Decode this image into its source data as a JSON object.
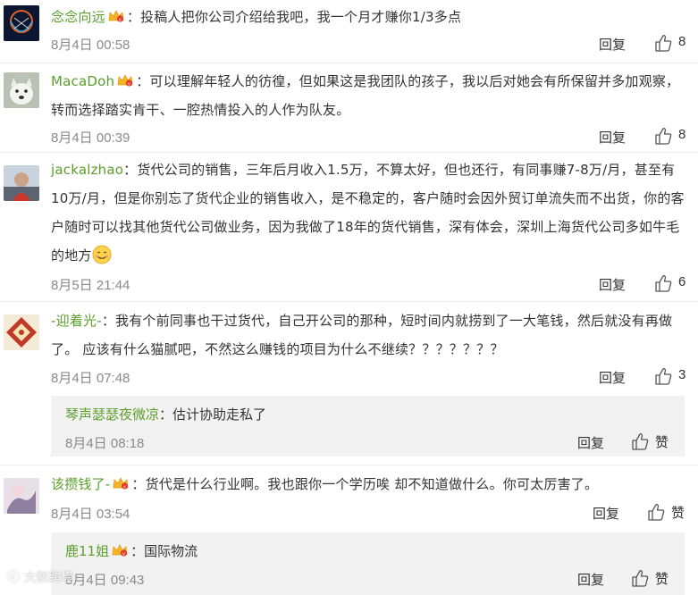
{
  "ui": {
    "reply_label": "回复",
    "like_label": "赞"
  },
  "comments": [
    {
      "user": "念念向远",
      "text": "：投稿人把你公司介绍给我吧，我一个月才赚你1/3多点",
      "time": "8月4日 00:58",
      "likes": "8"
    },
    {
      "user": "MacaDoh",
      "text": "：可以理解年轻人的彷徨，但如果这是我团队的孩子，我以后对她会有所保留并多加观察，转而选择踏实肯干、一腔热情投入的人作为队友。",
      "time": "8月4日 00:39",
      "likes": "8"
    },
    {
      "user": "jackalzhao",
      "text": "：货代公司的销售，三年后月收入1.5万，不算太好，但也还行，有同事赚7-8万/月，甚至有10万/月，但是你别忘了货代企业的销售收入，是不稳定的，客户随时会因外贸订单流失而不出货，你的客户随时可以找其他货代公司做业务，因为我做了18年的货代销售，深有体会，深圳上海货代公司多如牛毛的地方",
      "emoji": "smile-emoji",
      "time": "8月5日 21:44",
      "likes": "6"
    },
    {
      "user": "-迎着光-",
      "text": "：我有个前同事也干过货代，自己开公司的那种，短时间内就捞到了一大笔钱，然后就没有再做了。 应该有什么猫腻吧，不然这么赚钱的项目为什么不继续？？？？？？？",
      "time": "8月4日 07:48",
      "likes": "3",
      "reply": {
        "user": "琴声瑟瑟夜微凉",
        "text": "：估计协助走私了",
        "time": "8月4日 08:18"
      }
    },
    {
      "user": "该攒钱了-",
      "text": "：货代是什么行业啊。我也跟你一个学历唉 却不知道做什么。你可太厉害了。",
      "time": "8月4日 03:54",
      "reply": {
        "user": "鹿11姐",
        "text": "：国际物流",
        "time": "8月4日 09:43"
      }
    }
  ],
  "watermark": "大数跨境",
  "colors": {
    "username": "#5b9e2c",
    "time": "#8a8a8a",
    "reply_box": "#f2f2f2"
  }
}
